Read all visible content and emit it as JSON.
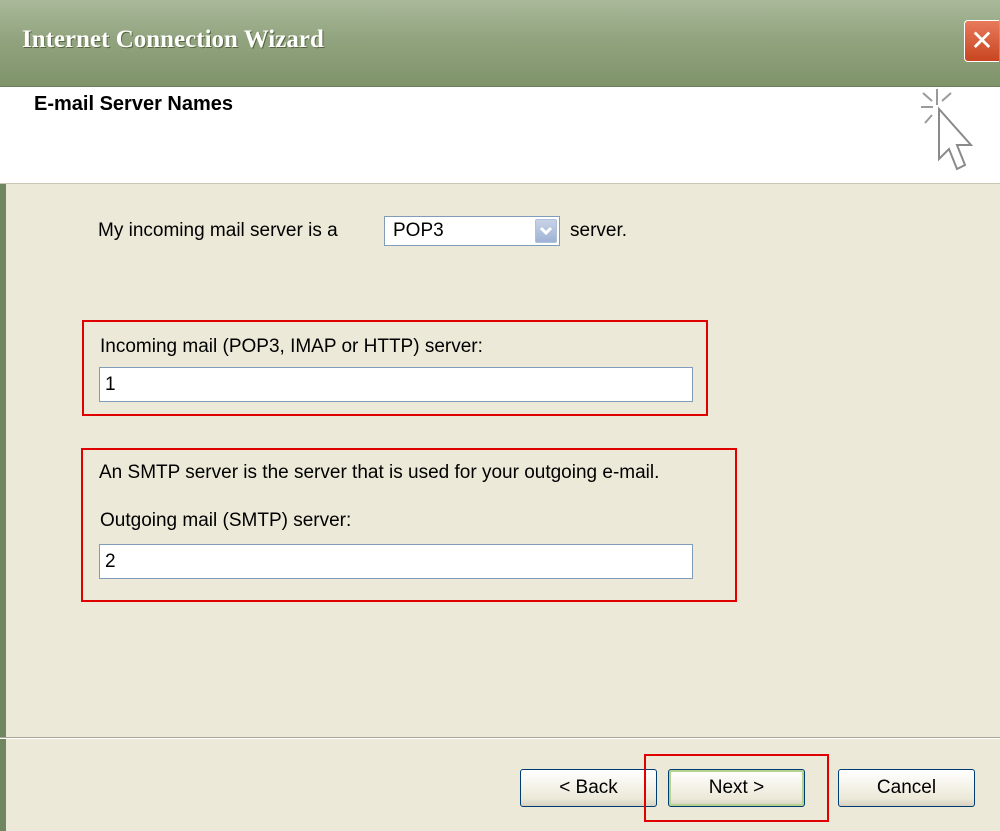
{
  "window": {
    "title": "Internet Connection Wizard",
    "close_label": "✕"
  },
  "header": {
    "title": "E-mail Server Names"
  },
  "incoming_type": {
    "prefix": "My incoming mail server is a",
    "selected": "POP3",
    "suffix": "server."
  },
  "incoming": {
    "label": "Incoming mail (POP3, IMAP or HTTP) server:",
    "value": "1"
  },
  "smtp": {
    "description": "An SMTP server is the server that is used for your outgoing e-mail.",
    "label": "Outgoing mail (SMTP) server:",
    "value": "2"
  },
  "buttons": {
    "back": "< Back",
    "next": "Next >",
    "cancel": "Cancel"
  },
  "colors": {
    "highlight": "#e00000",
    "titlebar": "#92a47f",
    "dialog": "#ece9d8"
  },
  "icons": {
    "close": "close-icon",
    "wizard": "wizard-cursor-icon",
    "dropdown": "chevron-down-icon"
  }
}
